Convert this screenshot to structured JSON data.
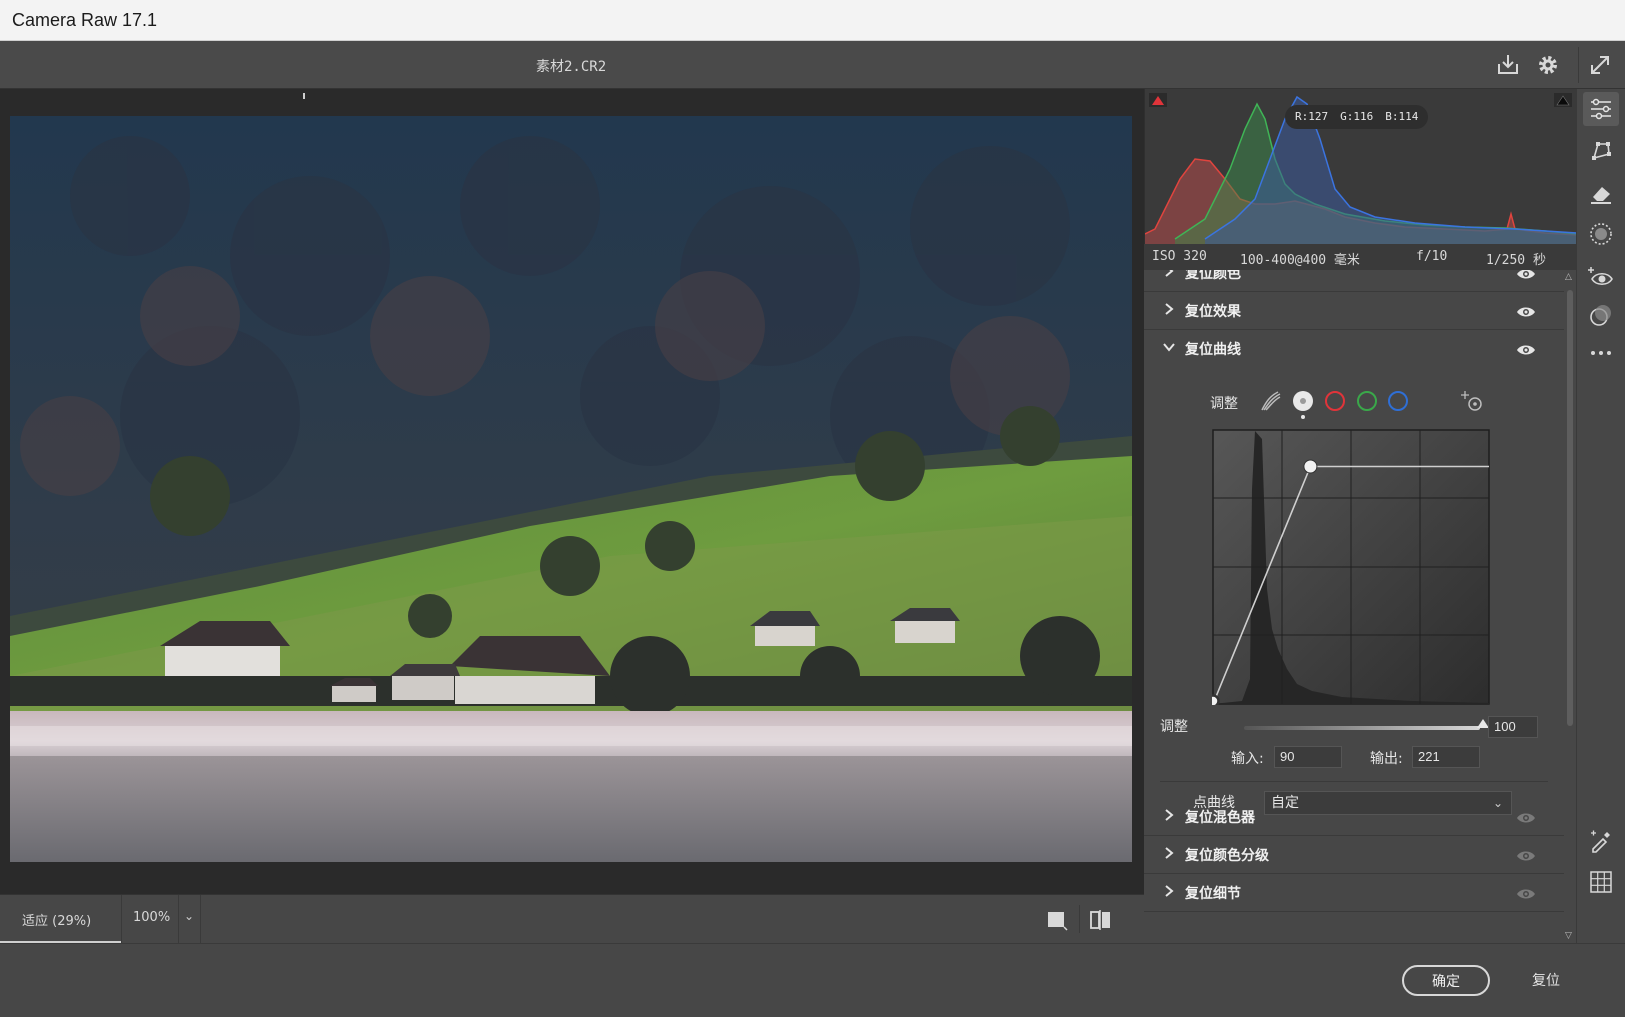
{
  "window": {
    "title": "Camera Raw 17.1"
  },
  "header": {
    "filename": "素材2.CR2",
    "icons": [
      "save-icon",
      "settings-gear-icon",
      "fullscreen-icon"
    ]
  },
  "histogram": {
    "readout": {
      "r": "R:127",
      "g": "G:116",
      "b": "B:114"
    },
    "exif": {
      "iso": "ISO 320",
      "lens": "100-400@400 毫米",
      "aperture": "f/10",
      "shutter": "1/250 秒"
    }
  },
  "panels": [
    {
      "label": "复位颜色",
      "expanded": false
    },
    {
      "label": "复位效果",
      "expanded": false
    },
    {
      "label": "复位曲线",
      "expanded": true
    },
    {
      "label": "复位混色器",
      "expanded": false
    },
    {
      "label": "复位颜色分级",
      "expanded": false
    },
    {
      "label": "复位细节",
      "expanded": false
    }
  ],
  "curve": {
    "tools_label": "调整",
    "channel_colors": {
      "red": "#e0343a",
      "green": "#3aa84a",
      "blue": "#2f6fd6"
    },
    "points": [
      [
        0,
        0
      ],
      [
        90,
        221
      ],
      [
        255,
        221
      ]
    ],
    "adjust_label": "调整",
    "adjust_value": "100",
    "adjust_fraction": 1.0,
    "input_label": "输入:",
    "input_value": "90",
    "output_label": "输出:",
    "output_value": "221",
    "point_curve_label": "点曲线",
    "point_curve_value": "自定"
  },
  "preview_bar": {
    "zoom_fit": "适应 (29%)",
    "zoom_100": "100%",
    "dropdown": "⌄"
  },
  "footer": {
    "ok": "确定",
    "reset": "复位"
  }
}
